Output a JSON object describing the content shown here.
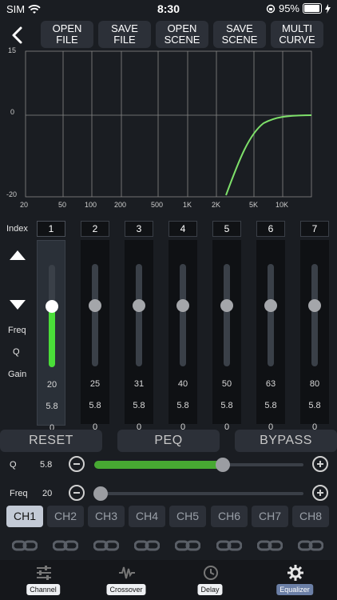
{
  "status": {
    "carrier": "SIM",
    "time": "8:30",
    "battery": "95%"
  },
  "toolbar": {
    "buttons": [
      "OPEN\nFILE",
      "SAVE\nFILE",
      "OPEN\nSCENE",
      "SAVE\nSCENE",
      "MULTI\nCURVE"
    ]
  },
  "graph": {
    "y_ticks": [
      "15",
      "0",
      "-20"
    ],
    "x_ticks": [
      "20",
      "50",
      "100",
      "200",
      "500",
      "1K",
      "2K",
      "5K",
      "10K"
    ],
    "curve_color": "#7ee06a"
  },
  "row_labels": {
    "index": "Index",
    "freq": "Freq",
    "q": "Q",
    "gain": "Gain"
  },
  "bands": [
    {
      "num": "1",
      "freq": "20",
      "q": "5.8",
      "gain": "0",
      "level": 0.58,
      "active": true
    },
    {
      "num": "2",
      "freq": "25",
      "q": "5.8",
      "gain": "0",
      "level": 0.58,
      "active": false
    },
    {
      "num": "3",
      "freq": "31",
      "q": "5.8",
      "gain": "0",
      "level": 0.58,
      "active": false
    },
    {
      "num": "4",
      "freq": "40",
      "q": "5.8",
      "gain": "0",
      "level": 0.58,
      "active": false
    },
    {
      "num": "5",
      "freq": "50",
      "q": "5.8",
      "gain": "0",
      "level": 0.58,
      "active": false
    },
    {
      "num": "6",
      "freq": "63",
      "q": "5.8",
      "gain": "0",
      "level": 0.58,
      "active": false
    },
    {
      "num": "7",
      "freq": "80",
      "q": "5.8",
      "gain": "0",
      "level": 0.58,
      "active": false
    }
  ],
  "actions": {
    "reset": "RESET",
    "peq": "PEQ",
    "bypass": "BYPASS"
  },
  "q_slider": {
    "label": "Q",
    "value": "5.8",
    "fraction": 0.61
  },
  "freq_slider": {
    "label": "Freq",
    "value": "20",
    "fraction": 0.0
  },
  "channels": [
    "CH1",
    "CH2",
    "CH3",
    "CH4",
    "CH5",
    "CH6",
    "CH7",
    "CH8"
  ],
  "selected_channel": "CH1",
  "nav": [
    {
      "label": "Channel",
      "icon": "sliders-icon"
    },
    {
      "label": "Crossover",
      "icon": "waveform-icon"
    },
    {
      "label": "Delay",
      "icon": "clock-icon"
    },
    {
      "label": "Equalizer",
      "icon": "gear-icon"
    }
  ],
  "colors": {
    "accent_green": "#4ade39",
    "slider_green": "#47a832",
    "nav_active": "#6b7fa6"
  }
}
